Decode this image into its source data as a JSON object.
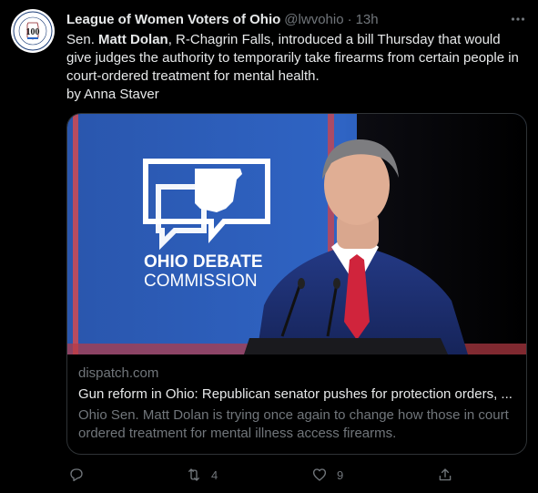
{
  "tweet": {
    "author_name": "League of Women Voters of Ohio",
    "handle": "@lwvohio",
    "separator": "·",
    "time": "13h",
    "text_prefix": "Sen. ",
    "text_bold": "Matt Dolan",
    "text_rest": ", R-Chagrin Falls, introduced a bill Thursday that would give judges the authority to temporarily take firearms from certain people in court-ordered treatment for mental health.",
    "byline": "by Anna Staver"
  },
  "avatar": {
    "badge_number": "100",
    "ring_text": "League of Women Voters"
  },
  "card": {
    "image_logo_line1": "OHIO DEBATE",
    "image_logo_line2": "COMMISSION",
    "domain": "dispatch.com",
    "title": "Gun reform in Ohio: Republican senator pushes for protection orders, ...",
    "description": "Ohio Sen. Matt Dolan is trying once again to change how those in court ordered treatment for mental illness access firearms."
  },
  "actions": {
    "reply_count": "",
    "retweet_count": "4",
    "like_count": "9",
    "share_count": ""
  },
  "colors": {
    "background": "#000000",
    "text_primary": "#e7e9ea",
    "text_secondary": "#71767b",
    "border": "#2f3336",
    "backdrop_blue": "#2f64c4",
    "tie_red": "#d0243c"
  },
  "icons": [
    "more-icon",
    "reply-icon",
    "retweet-icon",
    "like-icon",
    "share-icon"
  ]
}
